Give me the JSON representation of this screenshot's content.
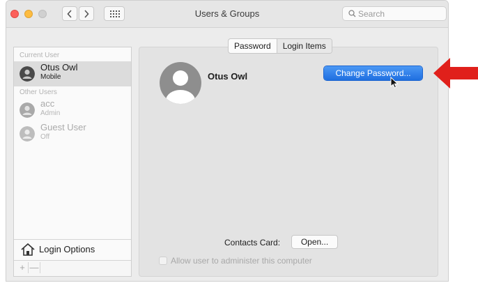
{
  "window": {
    "title": "Users & Groups"
  },
  "toolbar": {
    "back_icon": "chevron-left",
    "forward_icon": "chevron-right",
    "grid_icon": "show-all-grid",
    "search_placeholder": "Search"
  },
  "sidebar": {
    "current_user_label": "Current User",
    "other_users_label": "Other Users",
    "users": [
      {
        "name": "Otus Owl",
        "role": "Mobile",
        "selected": true
      },
      {
        "name": "acc",
        "role": "Admin",
        "selected": false
      },
      {
        "name": "Guest User",
        "role": "Off",
        "selected": false
      }
    ],
    "login_options_label": "Login Options",
    "add_label": "+",
    "remove_label": "—"
  },
  "tabs": {
    "password": "Password",
    "login_items": "Login Items",
    "selected": "Password"
  },
  "main": {
    "full_name": "Otus Owl",
    "change_password_label": "Change Password...",
    "contacts_card_label": "Contacts Card:",
    "open_label": "Open...",
    "admin_checkbox_label": "Allow user to administer this computer",
    "admin_checked": false
  },
  "colors": {
    "accent": "#2f7ff0",
    "annotation_arrow": "#e0201b",
    "close": "#fc605b",
    "minimize": "#fdbc40"
  }
}
